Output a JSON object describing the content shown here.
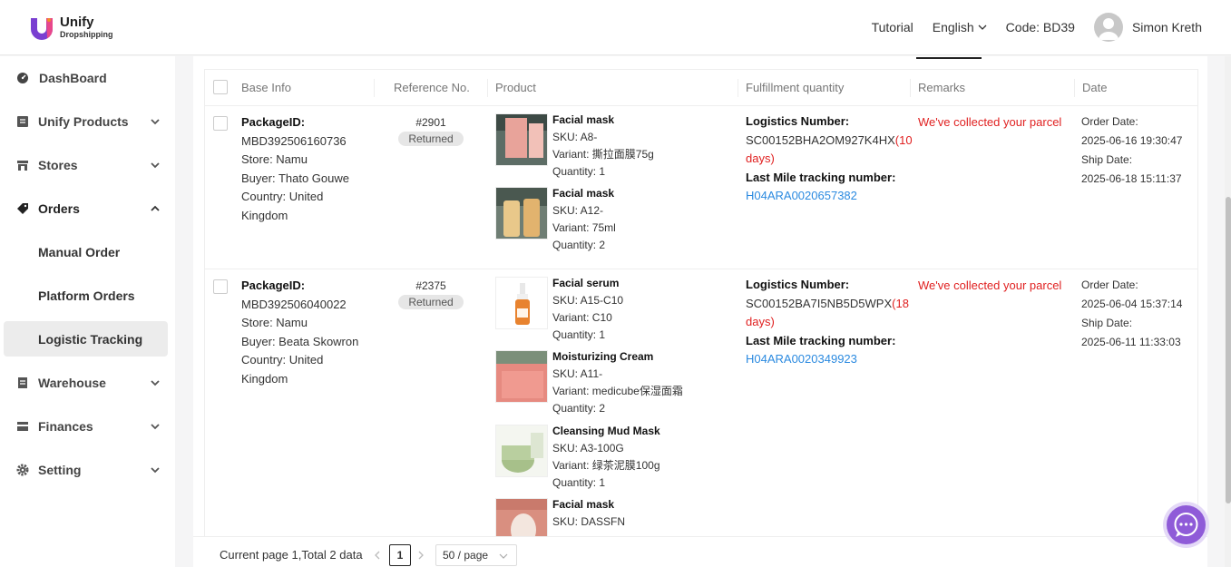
{
  "app": {
    "logo_name": "Unify",
    "logo_sub": "Dropshipping"
  },
  "header": {
    "tutorial": "Tutorial",
    "language": "English",
    "code": "Code: BD39",
    "user": "Simon Kreth"
  },
  "sidebar": {
    "items": [
      {
        "label": "DashBoard",
        "icon": "dashboard-icon"
      },
      {
        "label": "Unify Products",
        "icon": "products-icon"
      },
      {
        "label": "Stores",
        "icon": "store-icon"
      },
      {
        "label": "Orders",
        "icon": "tag-icon"
      },
      {
        "label": "Manual Order"
      },
      {
        "label": "Platform Orders"
      },
      {
        "label": "Logistic Tracking"
      },
      {
        "label": "Warehouse",
        "icon": "warehouse-icon"
      },
      {
        "label": "Finances",
        "icon": "finances-icon"
      },
      {
        "label": "Setting",
        "icon": "gear-icon"
      }
    ]
  },
  "table": {
    "headers": [
      "Base Info",
      "Reference No.",
      "Product",
      "Fulfillment quantity",
      "Remarks",
      "Date"
    ],
    "rows": [
      {
        "package_label": "PackageID:",
        "package_id": "MBD392506160736",
        "store": "Store: Namu",
        "buyer": "Buyer: Thato Gouwe",
        "country1": "Country: United",
        "country2": "Kingdom",
        "ref": "#2901",
        "status": "Returned",
        "products": [
          {
            "name": "Facial mask",
            "sku": "SKU: A8-",
            "variant": "Variant: 撕拉面膜75g",
            "qty": "Quantity: 1"
          },
          {
            "name": "Facial mask",
            "sku": "SKU: A12-",
            "variant": "Variant: 75ml",
            "qty": "Quantity: 2"
          }
        ],
        "logistics_label": "Logistics Number:",
        "logistics_no": "SC00152BHA2OM927K4HX",
        "days_a": "(10",
        "days_b": "days)",
        "lastmile_label": "Last Mile tracking number:",
        "lastmile_no": "H04ARA0020657382",
        "remarks": "We've collected your parcel",
        "order_label": "Order Date:",
        "order_date": "2025-06-16 19:30:47",
        "ship_label": "Ship Date:",
        "ship_date": "2025-06-18 15:11:37"
      },
      {
        "package_label": "PackageID:",
        "package_id": "MBD392506040022",
        "store": "Store: Namu",
        "buyer": "Buyer: Beata Skowron",
        "country1": "Country: United",
        "country2": "Kingdom",
        "ref": "#2375",
        "status": "Returned",
        "products": [
          {
            "name": "Facial serum",
            "sku": "SKU: A15-C10",
            "variant": "Variant: C10",
            "qty": "Quantity: 1"
          },
          {
            "name": "Moisturizing Cream",
            "sku": "SKU: A11-",
            "variant": "Variant: medicube保湿面霜",
            "qty": "Quantity: 2"
          },
          {
            "name": "Cleansing Mud Mask",
            "sku": "SKU: A3-100G",
            "variant": "Variant: 绿茶泥膜100g",
            "qty": "Quantity: 1"
          },
          {
            "name": "Facial mask",
            "sku": "SKU: DASSFN",
            "variant": "",
            "qty": ""
          }
        ],
        "logistics_label": "Logistics Number:",
        "logistics_no": "SC00152BA7I5NB5D5WPX",
        "days_a": "(18",
        "days_b": "days)",
        "lastmile_label": "Last Mile tracking number:",
        "lastmile_no": "H04ARA0020349923",
        "remarks": "We've collected your parcel",
        "order_label": "Order Date:",
        "order_date": "2025-06-04 15:37:14",
        "ship_label": "Ship Date:",
        "ship_date": "2025-06-11 11:33:03"
      }
    ]
  },
  "footer": {
    "summary": "Current page 1,Total 2 data",
    "page": "1",
    "page_size": "50 / page"
  }
}
